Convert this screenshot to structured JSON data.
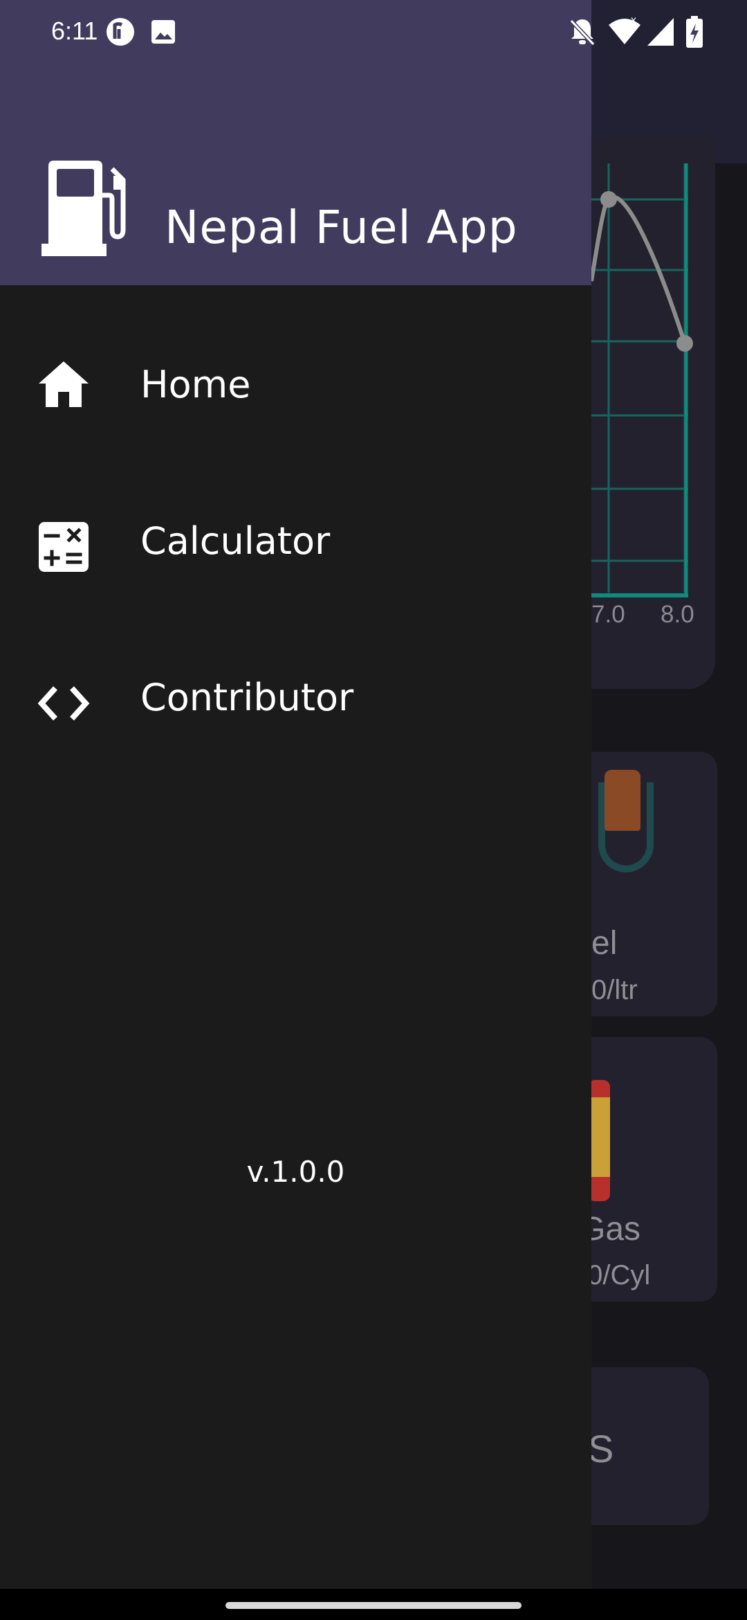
{
  "status_bar": {
    "time": "6:11",
    "left_icons": [
      "pocket-casts-icon",
      "image-icon"
    ],
    "right_icons": [
      "notifications-off-icon",
      "wifi-icon",
      "signal-icon",
      "battery-charging-icon"
    ]
  },
  "drawer": {
    "app_title": "Nepal Fuel App",
    "logo_icon": "fuel-pump-icon",
    "header_color": "#413c5d",
    "background_color": "#1c1b1b",
    "items": [
      {
        "label": "Home",
        "icon": "home-icon"
      },
      {
        "label": "Calculator",
        "icon": "calculator-icon"
      },
      {
        "label": "Contributor",
        "icon": "code-icon"
      }
    ],
    "version": "v.1.0.0"
  },
  "background": {
    "chart_ticks": [
      "7.0",
      "8.0"
    ],
    "cards": [
      {
        "name": "el",
        "price": "0/ltr"
      },
      {
        "name": "Gas",
        "price": ".0/Cyl"
      },
      {
        "name": "S"
      }
    ]
  }
}
